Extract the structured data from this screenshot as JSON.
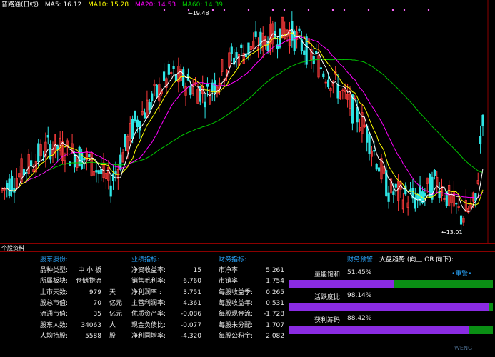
{
  "header": {
    "title": "普路通(日线)",
    "ma5": "MA5: 16.12",
    "ma10": "MA10: 15.28",
    "ma20": "MA20: 14.53",
    "ma60": "MA60: 14.39"
  },
  "colors": {
    "up": "#ff3b3b",
    "down": "#2ee6e6",
    "ma5": "#ffffff",
    "ma10": "#ffff00",
    "ma20": "#ff00ff",
    "ma60": "#00c800",
    "section_title": "#2aa7ff",
    "bar_fill": "#8a2be2",
    "bar_track": "#0a8f14"
  },
  "chart": {
    "high_label": "19.48",
    "low_label": "13.01"
  },
  "panel_title": "个股资料",
  "shareholders": {
    "title": "股东股份:",
    "rows": [
      {
        "label": "品种类型:",
        "value": "中 小 板",
        "unit": ""
      },
      {
        "label": "所属板块:",
        "value": "仓储物流",
        "unit": ""
      },
      {
        "label": "上市天数:",
        "value": "979",
        "unit": "天"
      },
      {
        "label": "股总市值:",
        "value": "70",
        "unit": "亿元"
      },
      {
        "label": "流通市值:",
        "value": "35",
        "unit": "亿元"
      },
      {
        "label": "股东人数:",
        "value": "34063",
        "unit": "人"
      },
      {
        "label": "人均持股:",
        "value": "5588",
        "unit": "股"
      }
    ]
  },
  "performance": {
    "title": "业绩指标:",
    "rows": [
      {
        "label": "净资收益率:",
        "value": "15"
      },
      {
        "label": "销售毛利率:",
        "value": "6.760"
      },
      {
        "label": "净利润率  :",
        "value": "3.751"
      },
      {
        "label": "主营利润率:",
        "value": "4.361"
      },
      {
        "label": "优质资产率:",
        "value": "-0.086"
      },
      {
        "label": "现金负债比:",
        "value": "-0.077"
      },
      {
        "label": "净利同增率:",
        "value": "-4.320"
      }
    ]
  },
  "financial": {
    "title": "财务指标:",
    "rows": [
      {
        "label": "市净率",
        "value": "5.261"
      },
      {
        "label": "市销率",
        "value": "1.754"
      },
      {
        "label": "每股收益季:",
        "value": "0.265"
      },
      {
        "label": "每股收益年:",
        "value": "0.531"
      },
      {
        "label": "每股现金流:",
        "value": "-1.728"
      },
      {
        "label": "每股未分配:",
        "value": "1.707"
      },
      {
        "label": "每股公积金:",
        "value": "2.082"
      }
    ]
  },
  "warning": {
    "title": "财务预警:",
    "trend": "大盘趋势 (向上 OR 向下):",
    "badge": "•重警•",
    "bars": [
      {
        "label": "量能饱和:",
        "text": "51.45%",
        "fraction": 0.5145
      },
      {
        "label": "活跃度比:",
        "text": "98.14%",
        "fraction": 0.9814
      },
      {
        "label": "获利筹码:",
        "text": "88.42%",
        "fraction": 0.8842
      }
    ]
  },
  "watermark": "WENG"
}
